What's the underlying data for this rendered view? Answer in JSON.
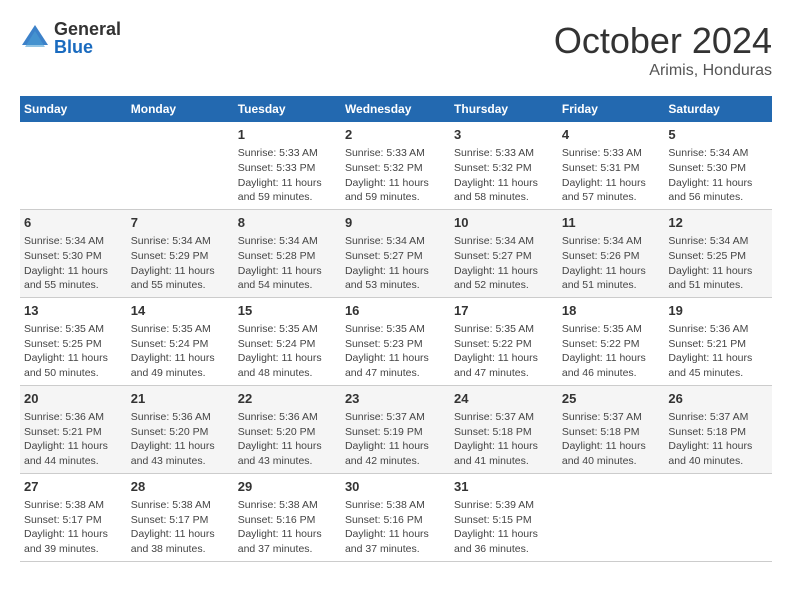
{
  "header": {
    "logo_general": "General",
    "logo_blue": "Blue",
    "month_title": "October 2024",
    "subtitle": "Arimis, Honduras"
  },
  "days_of_week": [
    "Sunday",
    "Monday",
    "Tuesday",
    "Wednesday",
    "Thursday",
    "Friday",
    "Saturday"
  ],
  "weeks": [
    [
      {
        "day": "",
        "info": ""
      },
      {
        "day": "",
        "info": ""
      },
      {
        "day": "1",
        "info": "Sunrise: 5:33 AM\nSunset: 5:33 PM\nDaylight: 11 hours and 59 minutes."
      },
      {
        "day": "2",
        "info": "Sunrise: 5:33 AM\nSunset: 5:32 PM\nDaylight: 11 hours and 59 minutes."
      },
      {
        "day": "3",
        "info": "Sunrise: 5:33 AM\nSunset: 5:32 PM\nDaylight: 11 hours and 58 minutes."
      },
      {
        "day": "4",
        "info": "Sunrise: 5:33 AM\nSunset: 5:31 PM\nDaylight: 11 hours and 57 minutes."
      },
      {
        "day": "5",
        "info": "Sunrise: 5:34 AM\nSunset: 5:30 PM\nDaylight: 11 hours and 56 minutes."
      }
    ],
    [
      {
        "day": "6",
        "info": "Sunrise: 5:34 AM\nSunset: 5:30 PM\nDaylight: 11 hours and 55 minutes."
      },
      {
        "day": "7",
        "info": "Sunrise: 5:34 AM\nSunset: 5:29 PM\nDaylight: 11 hours and 55 minutes."
      },
      {
        "day": "8",
        "info": "Sunrise: 5:34 AM\nSunset: 5:28 PM\nDaylight: 11 hours and 54 minutes."
      },
      {
        "day": "9",
        "info": "Sunrise: 5:34 AM\nSunset: 5:27 PM\nDaylight: 11 hours and 53 minutes."
      },
      {
        "day": "10",
        "info": "Sunrise: 5:34 AM\nSunset: 5:27 PM\nDaylight: 11 hours and 52 minutes."
      },
      {
        "day": "11",
        "info": "Sunrise: 5:34 AM\nSunset: 5:26 PM\nDaylight: 11 hours and 51 minutes."
      },
      {
        "day": "12",
        "info": "Sunrise: 5:34 AM\nSunset: 5:25 PM\nDaylight: 11 hours and 51 minutes."
      }
    ],
    [
      {
        "day": "13",
        "info": "Sunrise: 5:35 AM\nSunset: 5:25 PM\nDaylight: 11 hours and 50 minutes."
      },
      {
        "day": "14",
        "info": "Sunrise: 5:35 AM\nSunset: 5:24 PM\nDaylight: 11 hours and 49 minutes."
      },
      {
        "day": "15",
        "info": "Sunrise: 5:35 AM\nSunset: 5:24 PM\nDaylight: 11 hours and 48 minutes."
      },
      {
        "day": "16",
        "info": "Sunrise: 5:35 AM\nSunset: 5:23 PM\nDaylight: 11 hours and 47 minutes."
      },
      {
        "day": "17",
        "info": "Sunrise: 5:35 AM\nSunset: 5:22 PM\nDaylight: 11 hours and 47 minutes."
      },
      {
        "day": "18",
        "info": "Sunrise: 5:35 AM\nSunset: 5:22 PM\nDaylight: 11 hours and 46 minutes."
      },
      {
        "day": "19",
        "info": "Sunrise: 5:36 AM\nSunset: 5:21 PM\nDaylight: 11 hours and 45 minutes."
      }
    ],
    [
      {
        "day": "20",
        "info": "Sunrise: 5:36 AM\nSunset: 5:21 PM\nDaylight: 11 hours and 44 minutes."
      },
      {
        "day": "21",
        "info": "Sunrise: 5:36 AM\nSunset: 5:20 PM\nDaylight: 11 hours and 43 minutes."
      },
      {
        "day": "22",
        "info": "Sunrise: 5:36 AM\nSunset: 5:20 PM\nDaylight: 11 hours and 43 minutes."
      },
      {
        "day": "23",
        "info": "Sunrise: 5:37 AM\nSunset: 5:19 PM\nDaylight: 11 hours and 42 minutes."
      },
      {
        "day": "24",
        "info": "Sunrise: 5:37 AM\nSunset: 5:18 PM\nDaylight: 11 hours and 41 minutes."
      },
      {
        "day": "25",
        "info": "Sunrise: 5:37 AM\nSunset: 5:18 PM\nDaylight: 11 hours and 40 minutes."
      },
      {
        "day": "26",
        "info": "Sunrise: 5:37 AM\nSunset: 5:18 PM\nDaylight: 11 hours and 40 minutes."
      }
    ],
    [
      {
        "day": "27",
        "info": "Sunrise: 5:38 AM\nSunset: 5:17 PM\nDaylight: 11 hours and 39 minutes."
      },
      {
        "day": "28",
        "info": "Sunrise: 5:38 AM\nSunset: 5:17 PM\nDaylight: 11 hours and 38 minutes."
      },
      {
        "day": "29",
        "info": "Sunrise: 5:38 AM\nSunset: 5:16 PM\nDaylight: 11 hours and 37 minutes."
      },
      {
        "day": "30",
        "info": "Sunrise: 5:38 AM\nSunset: 5:16 PM\nDaylight: 11 hours and 37 minutes."
      },
      {
        "day": "31",
        "info": "Sunrise: 5:39 AM\nSunset: 5:15 PM\nDaylight: 11 hours and 36 minutes."
      },
      {
        "day": "",
        "info": ""
      },
      {
        "day": "",
        "info": ""
      }
    ]
  ]
}
